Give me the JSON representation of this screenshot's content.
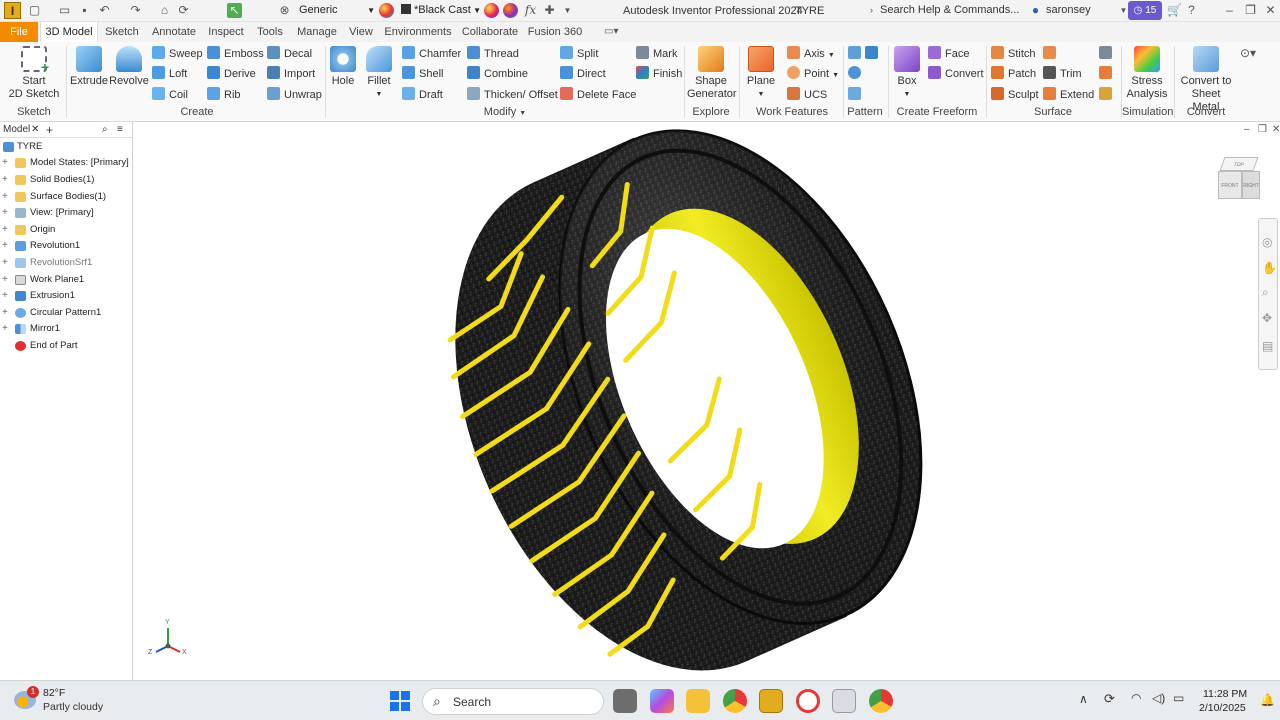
{
  "titlebar": {
    "app_title": "Autodesk Inventor Professional 2024",
    "doc_name": "TYRE",
    "search_placeholder": "Search Help & Commands...",
    "user": "saronsey",
    "notif_count": "15",
    "appearance": "Generic",
    "material": "*Black Cast"
  },
  "tabs": [
    "File",
    "3D Model",
    "Sketch",
    "Annotate",
    "Inspect",
    "Tools",
    "Manage",
    "View",
    "Environments",
    "Collaborate",
    "Fusion 360"
  ],
  "ribbon": {
    "sketch": {
      "start": "Start",
      "start2": "2D Sketch",
      "group": "Sketch"
    },
    "create": {
      "extrude": "Extrude",
      "revolve": "Revolve",
      "sweep": "Sweep",
      "loft": "Loft",
      "coil": "Coil",
      "emboss": "Emboss",
      "derive": "Derive",
      "rib": "Rib",
      "decal": "Decal",
      "import": "Import",
      "unwrap": "Unwrap",
      "group": "Create"
    },
    "modify": {
      "hole": "Hole",
      "fillet": "Fillet",
      "chamfer": "Chamfer",
      "shell": "Shell",
      "draft": "Draft",
      "thread": "Thread",
      "combine": "Combine",
      "thicken": "Thicken/ Offset",
      "split": "Split",
      "direct": "Direct",
      "delete_face": "Delete Face",
      "mark": "Mark",
      "finish": "Finish",
      "group": "Modify"
    },
    "explore": {
      "shape": "Shape",
      "generator": "Generator",
      "group": "Explore"
    },
    "work": {
      "plane": "Plane",
      "axis": "Axis",
      "point": "Point",
      "ucs": "UCS",
      "group": "Work Features"
    },
    "pattern": {
      "group": "Pattern"
    },
    "freeform": {
      "box": "Box",
      "face": "Face",
      "convert": "Convert",
      "group": "Create Freeform"
    },
    "surface": {
      "stitch": "Stitch",
      "patch": "Patch",
      "sculpt": "Sculpt",
      "trim": "Trim",
      "extend": "Extend",
      "group": "Surface"
    },
    "simulation": {
      "stress": "Stress",
      "analysis": "Analysis",
      "group": "Simulation"
    },
    "convert": {
      "to": "Convert to",
      "sheet": "Sheet Metal",
      "group": "Convert"
    }
  },
  "browser": {
    "tab": "Model",
    "root": "TYRE",
    "nodes": [
      "Model States: [Primary]",
      "Solid Bodies(1)",
      "Surface Bodies(1)",
      "View: [Primary]",
      "Origin",
      "Revolution1",
      "RevolutionSrf1",
      "Work Plane1",
      "Extrusion1",
      "Circular Pattern1",
      "Mirror1",
      "End of Part"
    ]
  },
  "viewcube": {
    "top": "TOP",
    "front": "FRONT",
    "right": "RIGHT"
  },
  "triad": {
    "x": "X",
    "y": "Y",
    "z": "Z"
  },
  "taskbar": {
    "weather_temp": "82°F",
    "weather_desc": "Partly cloudy",
    "weather_badge": "1",
    "search": "Search",
    "time": "11:28 PM",
    "date": "2/10/2025"
  },
  "colors": {
    "accent_orange": "#f28b00",
    "tread_yellow": "#f2dc18",
    "rubber": "#1c1c1c",
    "inner_yellow": "#e8e01a"
  }
}
